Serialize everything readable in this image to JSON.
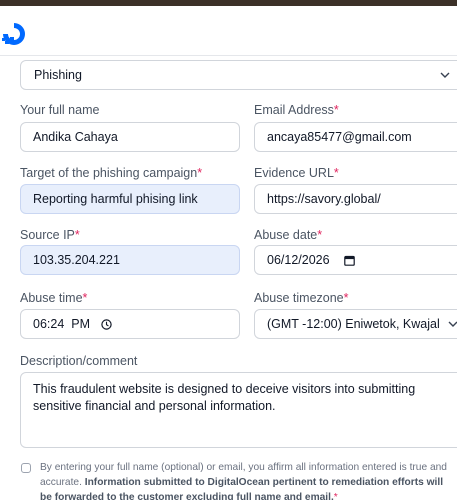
{
  "form": {
    "type_select": "Phishing",
    "full_name": {
      "label": "Your full name",
      "value": "Andika Cahaya"
    },
    "email": {
      "label": "Email Address",
      "required": "*",
      "value": "ancaya85477@gmail.com"
    },
    "target": {
      "label": "Target of the phishing campaign",
      "required": "*",
      "value": "Reporting harmful phising link"
    },
    "evidence_url": {
      "label": "Evidence URL",
      "required": "*",
      "value": "https://savory.global/"
    },
    "source_ip": {
      "label": "Source IP",
      "required": "*",
      "value": "103.35.204.221"
    },
    "abuse_date": {
      "label": "Abuse date",
      "required": "*",
      "value": "06/12/2026"
    },
    "abuse_time": {
      "label": "Abuse time",
      "required": "*",
      "value": "06:24  PM"
    },
    "abuse_timezone": {
      "label": "Abuse timezone",
      "required": "*",
      "value": "(GMT -12:00) Eniwetok, Kwajal"
    },
    "description": {
      "label": "Description/comment",
      "value": "This fraudulent website is designed to deceive visitors into submitting sensitive financial and personal information."
    },
    "consent": {
      "text_plain": "By entering your full name (optional) or email, you affirm all information entered is true and accurate. ",
      "text_bold": "Information submitted to DigitalOcean pertinent to remediation efforts will be forwarded to the customer excluding full name and email.",
      "required": "*"
    }
  },
  "colors": {
    "brand": "#0069ff",
    "required": "#e0245e",
    "autofill_bg": "#e8effc"
  },
  "icons": {
    "logo": "digitalocean-logo",
    "select_arrow": "chevron-down-icon",
    "date": "calendar-icon",
    "time": "clock-icon"
  }
}
